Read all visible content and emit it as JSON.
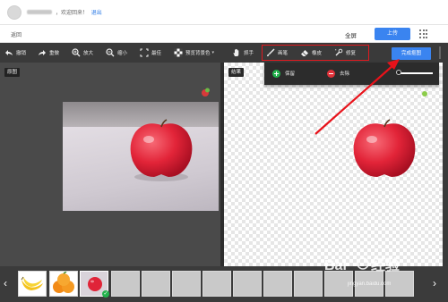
{
  "header": {
    "welcome_text": "，欢迎回来！",
    "logout_label": "退出"
  },
  "navbar": {
    "back_label": "返回",
    "fullscreen_label": "全屏",
    "upload_label": "上传"
  },
  "toolbar": {
    "items": [
      {
        "label": "撤销",
        "icon": "undo-icon"
      },
      {
        "label": "重做",
        "icon": "redo-icon"
      },
      {
        "label": "放大",
        "icon": "zoom-in-icon"
      },
      {
        "label": "缩小",
        "icon": "zoom-out-icon"
      },
      {
        "label": "最佳",
        "icon": "fit-icon"
      },
      {
        "label": "预览背景色",
        "icon": "checker-icon"
      },
      {
        "label": "抓手",
        "icon": "hand-icon"
      },
      {
        "label": "画笔",
        "icon": "brush-icon"
      },
      {
        "label": "橡皮",
        "icon": "eraser-icon"
      },
      {
        "label": "修复",
        "icon": "repair-icon"
      }
    ],
    "finish_label": "完成抠图"
  },
  "subbar": {
    "keep_label": "保留",
    "remove_label": "去除"
  },
  "panels": {
    "original_label": "原图",
    "result_label": "结果"
  },
  "filmstrip": {
    "thumbnails": [
      "banana",
      "oranges",
      "apple",
      "",
      "",
      "",
      "",
      "",
      "",
      "",
      "",
      "",
      ""
    ],
    "selected_index": 2
  },
  "watermark": {
    "text": "jingyan.baidu.com"
  },
  "colors": {
    "accent": "#3a84f0",
    "highlight": "#e0191f",
    "toolbar": "#3a3a3a"
  }
}
